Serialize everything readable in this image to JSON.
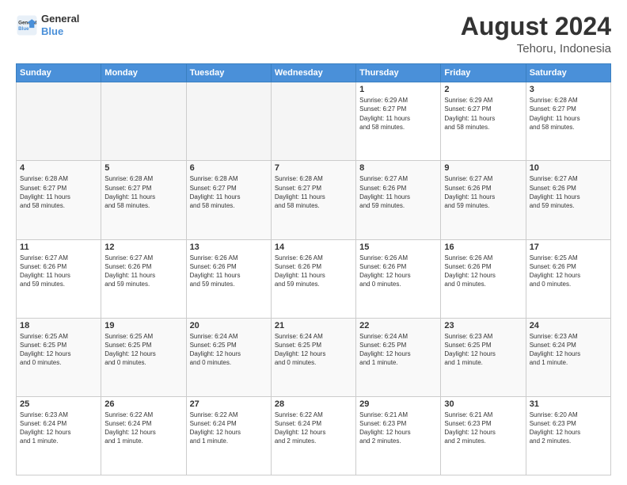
{
  "header": {
    "logo_line1": "General",
    "logo_line2": "Blue",
    "main_title": "August 2024",
    "subtitle": "Tehoru, Indonesia"
  },
  "days_of_week": [
    "Sunday",
    "Monday",
    "Tuesday",
    "Wednesday",
    "Thursday",
    "Friday",
    "Saturday"
  ],
  "weeks": [
    [
      {
        "day": "",
        "info": ""
      },
      {
        "day": "",
        "info": ""
      },
      {
        "day": "",
        "info": ""
      },
      {
        "day": "",
        "info": ""
      },
      {
        "day": "1",
        "info": "Sunrise: 6:29 AM\nSunset: 6:27 PM\nDaylight: 11 hours\nand 58 minutes."
      },
      {
        "day": "2",
        "info": "Sunrise: 6:29 AM\nSunset: 6:27 PM\nDaylight: 11 hours\nand 58 minutes."
      },
      {
        "day": "3",
        "info": "Sunrise: 6:28 AM\nSunset: 6:27 PM\nDaylight: 11 hours\nand 58 minutes."
      }
    ],
    [
      {
        "day": "4",
        "info": "Sunrise: 6:28 AM\nSunset: 6:27 PM\nDaylight: 11 hours\nand 58 minutes."
      },
      {
        "day": "5",
        "info": "Sunrise: 6:28 AM\nSunset: 6:27 PM\nDaylight: 11 hours\nand 58 minutes."
      },
      {
        "day": "6",
        "info": "Sunrise: 6:28 AM\nSunset: 6:27 PM\nDaylight: 11 hours\nand 58 minutes."
      },
      {
        "day": "7",
        "info": "Sunrise: 6:28 AM\nSunset: 6:27 PM\nDaylight: 11 hours\nand 58 minutes."
      },
      {
        "day": "8",
        "info": "Sunrise: 6:27 AM\nSunset: 6:26 PM\nDaylight: 11 hours\nand 59 minutes."
      },
      {
        "day": "9",
        "info": "Sunrise: 6:27 AM\nSunset: 6:26 PM\nDaylight: 11 hours\nand 59 minutes."
      },
      {
        "day": "10",
        "info": "Sunrise: 6:27 AM\nSunset: 6:26 PM\nDaylight: 11 hours\nand 59 minutes."
      }
    ],
    [
      {
        "day": "11",
        "info": "Sunrise: 6:27 AM\nSunset: 6:26 PM\nDaylight: 11 hours\nand 59 minutes."
      },
      {
        "day": "12",
        "info": "Sunrise: 6:27 AM\nSunset: 6:26 PM\nDaylight: 11 hours\nand 59 minutes."
      },
      {
        "day": "13",
        "info": "Sunrise: 6:26 AM\nSunset: 6:26 PM\nDaylight: 11 hours\nand 59 minutes."
      },
      {
        "day": "14",
        "info": "Sunrise: 6:26 AM\nSunset: 6:26 PM\nDaylight: 11 hours\nand 59 minutes."
      },
      {
        "day": "15",
        "info": "Sunrise: 6:26 AM\nSunset: 6:26 PM\nDaylight: 12 hours\nand 0 minutes."
      },
      {
        "day": "16",
        "info": "Sunrise: 6:26 AM\nSunset: 6:26 PM\nDaylight: 12 hours\nand 0 minutes."
      },
      {
        "day": "17",
        "info": "Sunrise: 6:25 AM\nSunset: 6:26 PM\nDaylight: 12 hours\nand 0 minutes."
      }
    ],
    [
      {
        "day": "18",
        "info": "Sunrise: 6:25 AM\nSunset: 6:25 PM\nDaylight: 12 hours\nand 0 minutes."
      },
      {
        "day": "19",
        "info": "Sunrise: 6:25 AM\nSunset: 6:25 PM\nDaylight: 12 hours\nand 0 minutes."
      },
      {
        "day": "20",
        "info": "Sunrise: 6:24 AM\nSunset: 6:25 PM\nDaylight: 12 hours\nand 0 minutes."
      },
      {
        "day": "21",
        "info": "Sunrise: 6:24 AM\nSunset: 6:25 PM\nDaylight: 12 hours\nand 0 minutes."
      },
      {
        "day": "22",
        "info": "Sunrise: 6:24 AM\nSunset: 6:25 PM\nDaylight: 12 hours\nand 1 minute."
      },
      {
        "day": "23",
        "info": "Sunrise: 6:23 AM\nSunset: 6:25 PM\nDaylight: 12 hours\nand 1 minute."
      },
      {
        "day": "24",
        "info": "Sunrise: 6:23 AM\nSunset: 6:24 PM\nDaylight: 12 hours\nand 1 minute."
      }
    ],
    [
      {
        "day": "25",
        "info": "Sunrise: 6:23 AM\nSunset: 6:24 PM\nDaylight: 12 hours\nand 1 minute."
      },
      {
        "day": "26",
        "info": "Sunrise: 6:22 AM\nSunset: 6:24 PM\nDaylight: 12 hours\nand 1 minute."
      },
      {
        "day": "27",
        "info": "Sunrise: 6:22 AM\nSunset: 6:24 PM\nDaylight: 12 hours\nand 1 minute."
      },
      {
        "day": "28",
        "info": "Sunrise: 6:22 AM\nSunset: 6:24 PM\nDaylight: 12 hours\nand 2 minutes."
      },
      {
        "day": "29",
        "info": "Sunrise: 6:21 AM\nSunset: 6:23 PM\nDaylight: 12 hours\nand 2 minutes."
      },
      {
        "day": "30",
        "info": "Sunrise: 6:21 AM\nSunset: 6:23 PM\nDaylight: 12 hours\nand 2 minutes."
      },
      {
        "day": "31",
        "info": "Sunrise: 6:20 AM\nSunset: 6:23 PM\nDaylight: 12 hours\nand 2 minutes."
      }
    ]
  ]
}
